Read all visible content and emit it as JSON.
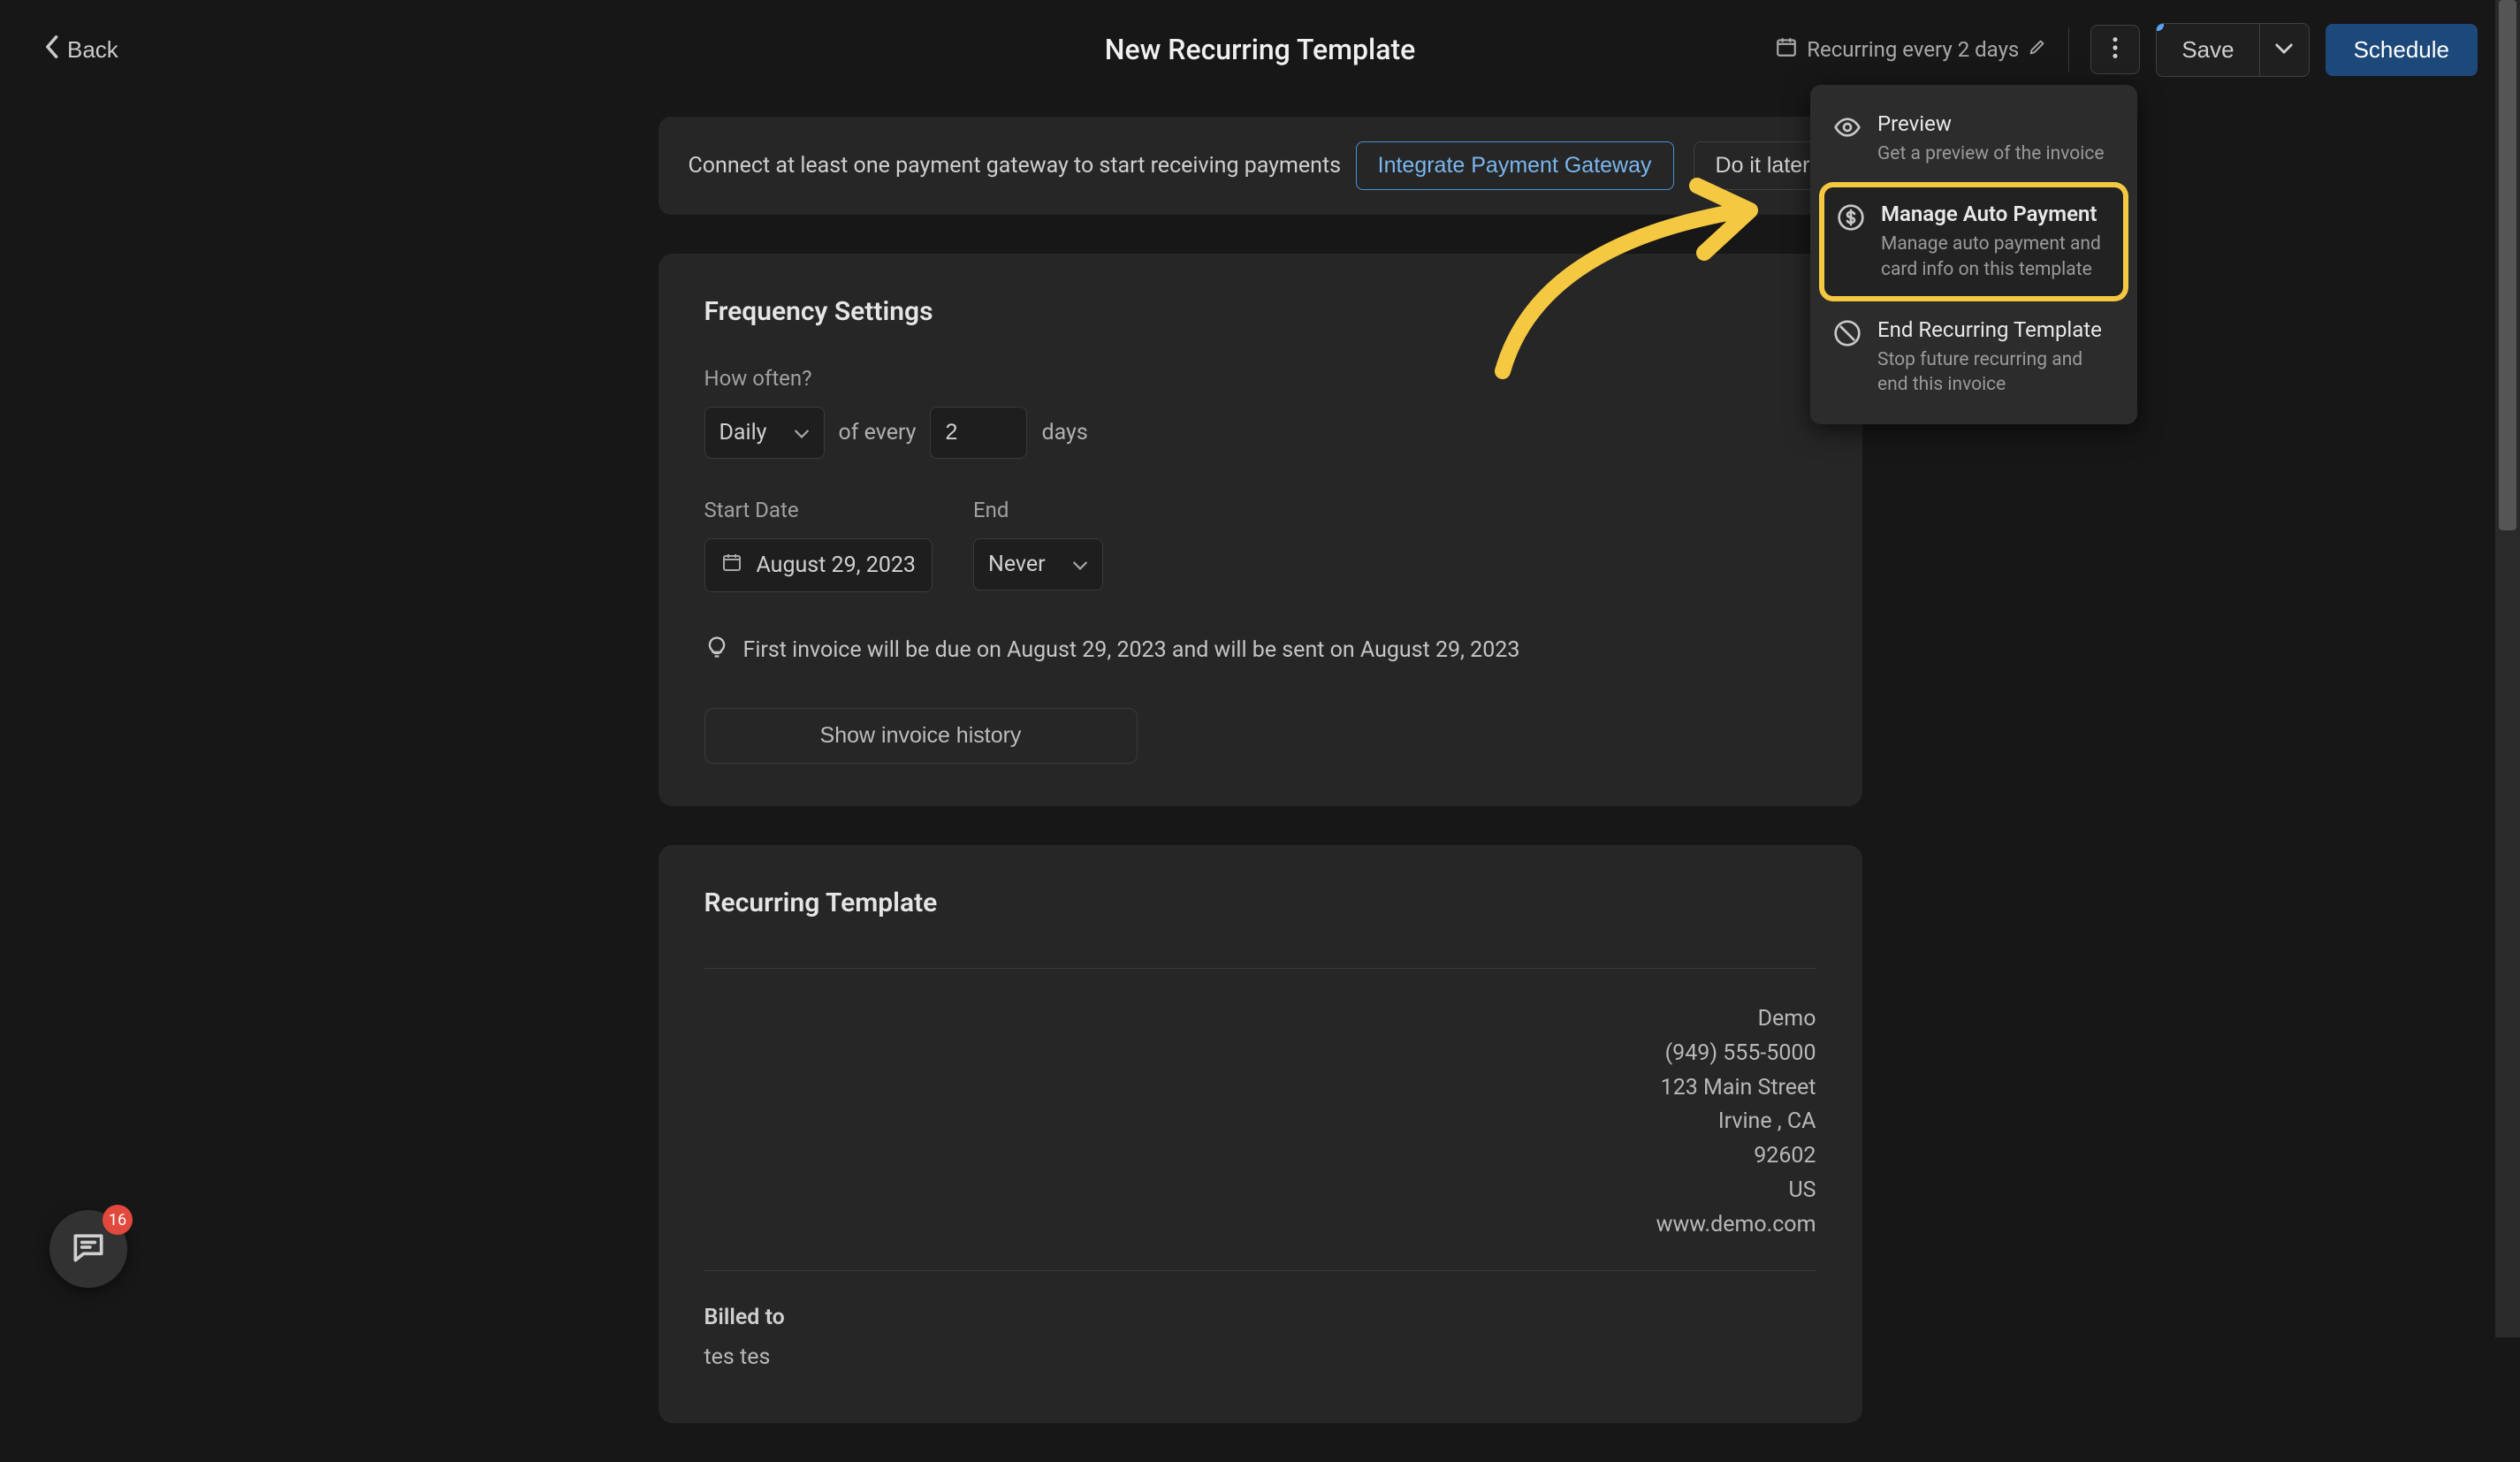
{
  "header": {
    "back_label": "Back",
    "title": "New Recurring Template",
    "recurring_text": "Recurring every 2 days",
    "save_label": "Save",
    "schedule_label": "Schedule"
  },
  "alert": {
    "text": "Connect at least one payment gateway to start receiving payments",
    "integrate_label": "Integrate Payment Gateway",
    "later_label": "Do it later"
  },
  "frequency": {
    "title": "Frequency Settings",
    "how_often_label": "How often?",
    "period_value": "Daily",
    "of_every": "of every",
    "number_value": "2",
    "unit": "days",
    "start_date_label": "Start Date",
    "start_date_value": "August 29, 2023",
    "end_label": "End",
    "end_value": "Never",
    "hint": "First invoice will be due on August 29, 2023 and will be sent on August 29, 2023",
    "history_button": "Show invoice history"
  },
  "invoice": {
    "title": "Recurring Template",
    "company": {
      "name": "Demo",
      "phone": "(949) 555-5000",
      "street": "123 Main Street",
      "city_state": "Irvine , CA",
      "zip": "92602",
      "country": "US",
      "website": "www.demo.com"
    },
    "billed_to_label": "Billed to",
    "billed_name": "tes tes"
  },
  "menu": {
    "preview": {
      "title": "Preview",
      "desc": "Get a preview of the invoice"
    },
    "auto_payment": {
      "title": "Manage Auto Payment",
      "desc": "Manage auto payment and card info on this template"
    },
    "end_recurring": {
      "title": "End Recurring Template",
      "desc": "Stop future recurring and end this invoice"
    }
  },
  "chat": {
    "badge": "16"
  }
}
